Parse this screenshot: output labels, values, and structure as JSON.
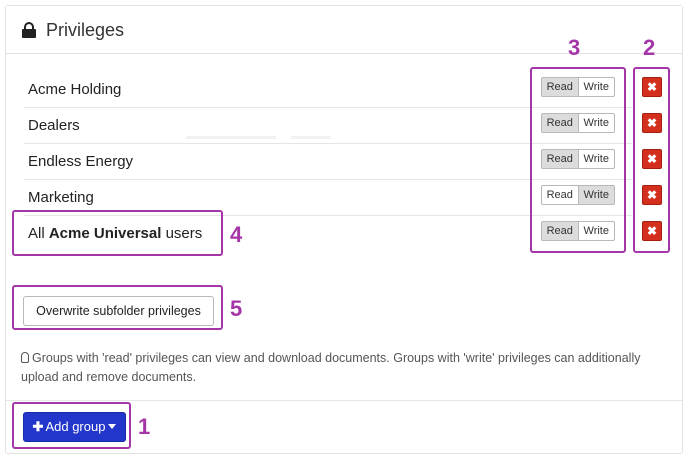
{
  "header": {
    "title": "Privileges",
    "icon": "lock-icon"
  },
  "groups": [
    {
      "name": "Acme Holding",
      "read_label": "Read",
      "write_label": "Write",
      "selected": "read",
      "delete_icon": "✖"
    },
    {
      "name": "Dealers",
      "read_label": "Read",
      "write_label": "Write",
      "selected": "read",
      "delete_icon": "✖"
    },
    {
      "name": "Endless Energy",
      "read_label": "Read",
      "write_label": "Write",
      "selected": "read",
      "delete_icon": "✖"
    },
    {
      "name": "Marketing",
      "read_label": "Read",
      "write_label": "Write",
      "selected": "write",
      "delete_icon": "✖"
    },
    {
      "name_prefix": "All ",
      "name_bold": "Acme Universal",
      "name_suffix": " users",
      "read_label": "Read",
      "write_label": "Write",
      "selected": "read",
      "delete_icon": "✖"
    }
  ],
  "overwrite_button": "Overwrite subfolder privileges",
  "hint": "Groups with 'read' privileges can view and download documents. Groups with 'write' privileges can additionally upload and remove documents.",
  "add_group_button": "Add group",
  "markers": {
    "m1": "1",
    "m2": "2",
    "m3": "3",
    "m4": "4",
    "m5": "5"
  },
  "colors": {
    "accent": "#2236cc",
    "danger": "#d42e1c",
    "highlight": "#a536a8"
  }
}
